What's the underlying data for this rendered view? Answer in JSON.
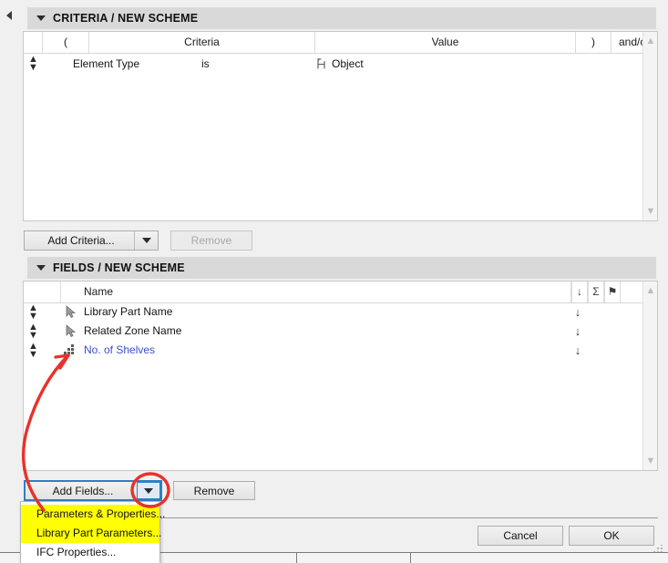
{
  "window": {
    "collapse_arrow_icon": "left-triangle-icon"
  },
  "criteria_section": {
    "title": "CRITERIA /  NEW SCHEME",
    "expanded_icon": "triangle-down-icon",
    "columns": [
      {
        "label": "(",
        "name": "open-paren"
      },
      {
        "label": "Criteria",
        "name": "criteria"
      },
      {
        "label": "Value",
        "name": "value"
      },
      {
        "label": ")",
        "name": "close-paren"
      },
      {
        "label": "and/or",
        "name": "and-or"
      }
    ],
    "rows": [
      {
        "reorder_icon": "up-down-arrows-icon",
        "criteria": "Element Type",
        "operator": "is",
        "value_icon": "object-chair-icon",
        "value": "Object"
      }
    ],
    "scrollbar": {
      "up_icon": "chevron-up-icon",
      "down_icon": "chevron-down-icon"
    }
  },
  "criteria_toolbar": {
    "add_label": "Add Criteria...",
    "add_dropdown_icon": "triangle-down-icon",
    "remove_label": "Remove",
    "remove_disabled": true
  },
  "fields_section": {
    "title": "FIELDS /  NEW SCHEME",
    "expanded_icon": "triangle-down-icon",
    "columns": [
      {
        "label": "Name",
        "name": "name"
      }
    ],
    "header_icons": [
      {
        "glyph": "↓",
        "name": "sort-descending-icon"
      },
      {
        "glyph": "Σ",
        "name": "sum-sigma-icon"
      },
      {
        "glyph": "⚑",
        "name": "flag-icon"
      }
    ],
    "rows": [
      {
        "reorder_icon": "up-down-arrows-icon",
        "type_icon": "cursor-arrow-icon",
        "name": "Library Part Name",
        "sort_icon": "↓",
        "highlighted": false
      },
      {
        "reorder_icon": "up-down-arrows-icon",
        "type_icon": "cursor-arrow-icon",
        "name": "Related Zone Name",
        "sort_icon": "↓",
        "highlighted": false
      },
      {
        "reorder_icon": "up-down-arrows-icon",
        "type_icon": "parameter-grid-icon",
        "name": "No. of Shelves",
        "sort_icon": "↓",
        "highlighted": true
      }
    ],
    "scrollbar": {
      "up_icon": "chevron-up-icon",
      "down_icon": "chevron-down-icon"
    }
  },
  "fields_toolbar": {
    "add_label": "Add Fields...",
    "add_dropdown_icon": "triangle-down-icon",
    "remove_label": "Remove"
  },
  "dropdown_menu": {
    "items": [
      {
        "label": "Parameters & Properties...",
        "highlighted": true
      },
      {
        "label": "Library Part Parameters...",
        "highlighted": true
      },
      {
        "label": "IFC Properties...",
        "highlighted": false
      }
    ]
  },
  "footer": {
    "cancel_label": "Cancel",
    "ok_label": "OK",
    "resize_grip_icon": "resize-grip-icon"
  },
  "annotations": {
    "arrow_icon": "red-arrow-annotation",
    "circle_icon": "red-circle-annotation",
    "color": "#e8322a"
  }
}
